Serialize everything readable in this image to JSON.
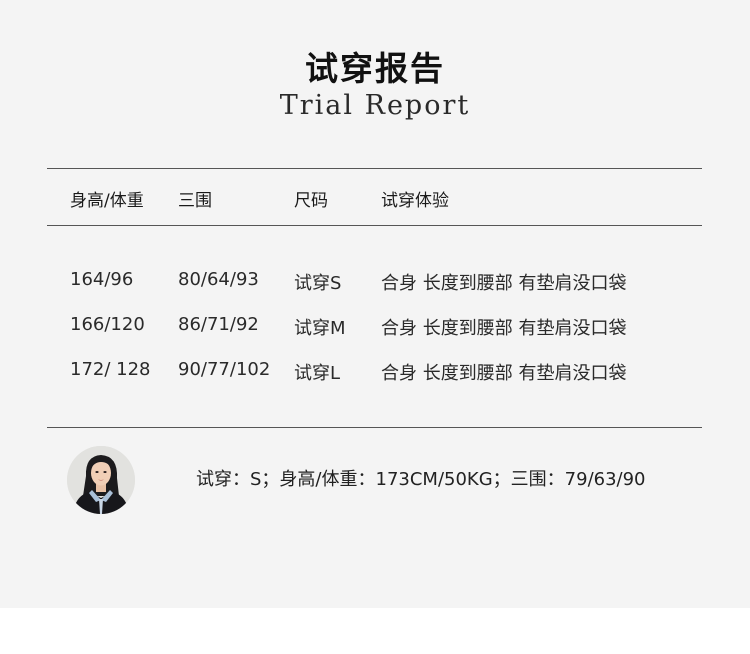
{
  "title_cn": "试穿报告",
  "title_en": "Trial Report",
  "headers": {
    "height_weight": "身高/体重",
    "measurements": "三围",
    "size": "尺码",
    "experience": "试穿体验"
  },
  "rows": [
    {
      "height_weight": "164/96",
      "measurements": "80/64/93",
      "size": "试穿S",
      "experience": "合身 长度到腰部 有垫肩没口袋"
    },
    {
      "height_weight": "166/120",
      "measurements": "86/71/92",
      "size": "试穿M",
      "experience": "合身 长度到腰部 有垫肩没口袋"
    },
    {
      "height_weight": "172/ 128",
      "measurements": "90/77/102",
      "size": "试穿L",
      "experience": "合身 长度到腰部 有垫肩没口袋"
    }
  ],
  "model": {
    "summary": "试穿：S；身高/体重：173CM/50KG；三围：79/63/90"
  }
}
